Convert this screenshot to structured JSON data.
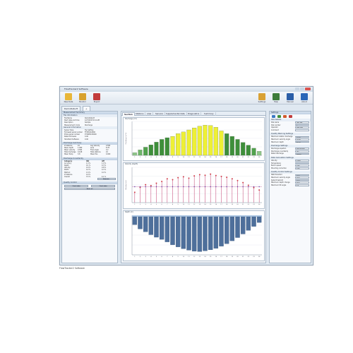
{
  "window": {
    "title": "FlowTracker2 Software"
  },
  "caption": "FlowTracker2 Software",
  "toolbar": {
    "left": [
      {
        "label": "New Data",
        "color": "#e8b637"
      },
      {
        "label": "Monitor",
        "color": "#d8a22e"
      },
      {
        "label": "Export",
        "color": "#c23b3b"
      }
    ],
    "right": [
      {
        "label": "Settings",
        "color": "#d9a134"
      },
      {
        "label": "Help",
        "color": "#3d7c3a"
      },
      {
        "label": "Manual",
        "color": "#2b5ea7"
      },
      {
        "label": "About",
        "color": "#2a67b8"
      }
    ]
  },
  "session_tabs": {
    "file": "DemoData.ft",
    "add": "+"
  },
  "left_panel": {
    "measurement_summary": {
      "title": "Measurement Summary",
      "file_info_title": "File Information",
      "file_info": [
        [
          "File Name",
          "DemoData.ft"
        ],
        [
          "Start date and time",
          "12/7/2015 9:14 AM"
        ],
        [
          "Description",
          "Sample"
        ],
        [
          "Measurement mode",
          "Discharge"
        ]
      ],
      "general_info_title": "General Information",
      "general_info": [
        [
          "Sensor Type",
          "Top Setting"
        ],
        [
          "Firmware serial number",
          "FT2E0116000"
        ],
        [
          "Probe serial number",
          "P716E0130000"
        ],
        [
          "Rated Firmware",
          "0.40"
        ],
        [
          "Handheld Software",
          "0.40"
        ]
      ]
    },
    "discharge_summary": {
      "title": "Discharge Summary",
      "rows": [
        [
          "# Stations",
          "24",
          "Avg Velocity",
          "0.582"
        ],
        [
          "Mean depth",
          "1.080",
          "Area",
          "8.78"
        ],
        [
          "Mean velocity",
          "0.582",
          "Flow angle",
          "0.2"
        ],
        [
          "Total discharge",
          "0.108",
          "Total stations",
          "24"
        ],
        [
          "Mean Temp",
          "3.8",
          "Mean Pos",
          "0.000"
        ]
      ]
    },
    "discharge_uncertainty": {
      "title": "Discharge Uncertainty",
      "header": [
        "Category",
        "ISO",
        "IVE"
      ],
      "rows": [
        [
          "Accuracy",
          "1.0 %",
          "1.0 %"
        ],
        [
          "Depth",
          "0.1 %",
          "0.3 %"
        ],
        [
          "Velocity",
          "0.9 %",
          "0.8 %"
        ],
        [
          "Width",
          "0.2 %",
          "0.3 %"
        ],
        [
          "Method",
          "1.6 %",
          "0.4 %"
        ],
        [
          "# Stations",
          "0.9 %",
          ""
        ],
        [
          "Overall",
          "3.5 %",
          "4.1 %"
        ]
      ],
      "button": "Show as..."
    },
    "quality_control": {
      "title": "Quality Control",
      "buttons": [
        "Check data",
        "Check data"
      ],
      "reset_button": "Reset all"
    }
  },
  "center": {
    "tabs": [
      "Section",
      "Stations",
      "area",
      "Sensors",
      "Supplemental data",
      "Diagnostics",
      "Summary"
    ],
    "active_tab": "Section",
    "charts": {
      "discharge": {
        "title": "Discharge (m³)",
        "ylabel": "Discharge (m³/s)",
        "type": "bar",
        "categories": [
          "1",
          "2",
          "3",
          "4",
          "5",
          "6",
          "7",
          "8",
          "9",
          "10",
          "11",
          "12",
          "13",
          "14",
          "15",
          "16",
          "17",
          "18",
          "19",
          "20",
          "21",
          "22",
          "23",
          "24"
        ],
        "values": [
          0.8,
          1.6,
          2.4,
          3.1,
          3.9,
          4.7,
          5.2,
          5.6,
          6.4,
          6.9,
          7.5,
          8.1,
          8.6,
          8.9,
          8.8,
          8.3,
          7.2,
          6.4,
          5.6,
          4.7,
          3.8,
          3.0,
          2.1,
          1.2
        ],
        "colors": [
          "#8fc78a",
          "#6fb56a",
          "#51a24d",
          "#3e8f3a",
          "#3e8f3a",
          "#3e8f3a",
          "#3e8f3a",
          "#eef035",
          "#eef035",
          "#eef035",
          "#eef035",
          "#eef035",
          "#eef035",
          "#eef035",
          "#eef035",
          "#eef035",
          "#eef035",
          "#3e8f3a",
          "#3e8f3a",
          "#3e8f3a",
          "#3e8f3a",
          "#3e8f3a",
          "#51a24d",
          "#8fc78a"
        ],
        "ylim": [
          0,
          10
        ]
      },
      "velocity": {
        "title": "Velocity (depth)",
        "ylabel": "Velocity (m/s)",
        "type": "scatter",
        "x": [
          1,
          2,
          3,
          4,
          5,
          6,
          7,
          8,
          9,
          10,
          11,
          12,
          13,
          14,
          15,
          16,
          17,
          18,
          19,
          20,
          21,
          22,
          23,
          24
        ],
        "values": [
          0.35,
          0.52,
          0.61,
          0.58,
          0.66,
          0.72,
          0.81,
          0.78,
          0.85,
          0.88,
          0.83,
          0.91,
          0.95,
          0.93,
          0.97,
          0.92,
          0.89,
          0.86,
          0.81,
          0.75,
          0.68,
          0.59,
          0.51,
          0.43
        ],
        "ylim": [
          0,
          1.2
        ]
      },
      "depth": {
        "title": "Depth (m)",
        "type": "bar",
        "categories": [
          "1",
          "2",
          "3",
          "4",
          "5",
          "6",
          "7",
          "8",
          "9",
          "10",
          "11",
          "12",
          "13",
          "14",
          "15",
          "16",
          "17",
          "18",
          "19",
          "20",
          "21",
          "22",
          "23",
          "24"
        ],
        "values": [
          0.22,
          0.34,
          0.42,
          0.5,
          0.57,
          0.63,
          0.7,
          0.78,
          0.84,
          0.89,
          0.93,
          0.96,
          0.97,
          0.95,
          0.92,
          0.88,
          0.82,
          0.75,
          0.67,
          0.58,
          0.48,
          0.38,
          0.27,
          0.16
        ],
        "ylim": [
          0,
          1.1
        ],
        "color": "#4e6f9b"
      }
    }
  },
  "right_panel": {
    "title": "Settings",
    "site_title": "Site Details",
    "site_rows": [
      [
        "Site name",
        "Test Site"
      ],
      [
        "Site number",
        "1"
      ],
      [
        "Operator",
        "John Doe"
      ],
      [
        "Comment",
        ""
      ]
    ],
    "qc_title": "Quality Warning Settings",
    "qc_rows": [
      [
        "Maximum station discharge",
        "10.00"
      ],
      [
        "Maximum velocity angle",
        "20.00"
      ],
      [
        "Maximum depth",
        "80.00"
      ]
    ],
    "disch_title": "Discharge Settings",
    "disch_rows": [
      [
        "Discharge equation",
        "Mid Section"
      ],
      [
        "Discharge uncertainty",
        "ISO"
      ],
      [
        "Rated discharge",
        "Robust"
      ]
    ],
    "calc_title": "Data Calculation Settings",
    "calc_rows": [
      [
        "Velocity",
        "0.000"
      ],
      [
        "Temperature",
        ""
      ],
      [
        "Bench speed",
        "0.00"
      ],
      [
        "Mounting correction",
        "0.00"
      ]
    ],
    "qcs_title": "Quality Control Settings",
    "qcs_rows": [
      [
        "SNR threshold",
        "10.0"
      ],
      [
        "Maximum velocity angle",
        "20.0"
      ],
      [
        "Spike threshold",
        "10.0"
      ],
      [
        "Maximum depth change",
        "50.0"
      ],
      [
        "Maximum tilt angle",
        "5.0"
      ]
    ]
  }
}
